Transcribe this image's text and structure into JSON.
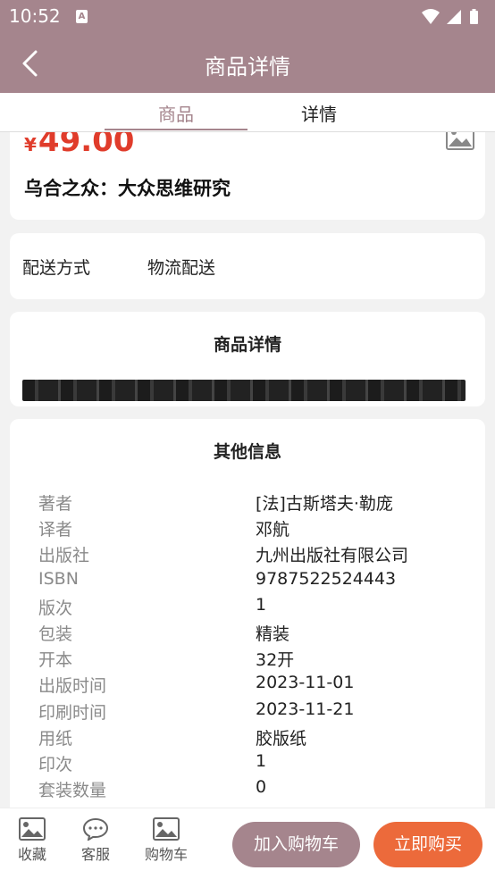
{
  "status_bar": {
    "time": "10:52",
    "notification_badge": "A"
  },
  "header": {
    "title": "商品详情"
  },
  "tabs": [
    {
      "label": "商品"
    },
    {
      "label": "详情"
    }
  ],
  "product": {
    "currency": "¥",
    "price": "49.00",
    "title": "乌合之众：大众思维研究"
  },
  "delivery": {
    "label": "配送方式",
    "value": "物流配送"
  },
  "detail_section": {
    "heading": "商品详情"
  },
  "other_info": {
    "heading": "其他信息",
    "rows": [
      {
        "key": "著者",
        "value": "[法]古斯塔夫·勒庞"
      },
      {
        "key": "译者",
        "value": "邓航"
      },
      {
        "key": "出版社",
        "value": "九州出版社有限公司"
      },
      {
        "key": "ISBN",
        "value": "9787522524443"
      },
      {
        "key": "版次",
        "value": "1"
      },
      {
        "key": "包装",
        "value": "精装"
      },
      {
        "key": "开本",
        "value": "32开"
      },
      {
        "key": "出版时间",
        "value": "2023-11-01"
      },
      {
        "key": "印刷时间",
        "value": "2023-11-21"
      },
      {
        "key": "用纸",
        "value": "胶版纸"
      },
      {
        "key": "印次",
        "value": "1"
      },
      {
        "key": "套装数量",
        "value": "0"
      }
    ]
  },
  "bottom_bar": {
    "favorite": "收藏",
    "service": "客服",
    "cart": "购物车",
    "add_to_cart": "加入购物车",
    "buy_now": "立即购买"
  },
  "colors": {
    "theme": "#a5858d",
    "price": "#e03c2b",
    "buy": "#ec6a3b"
  }
}
